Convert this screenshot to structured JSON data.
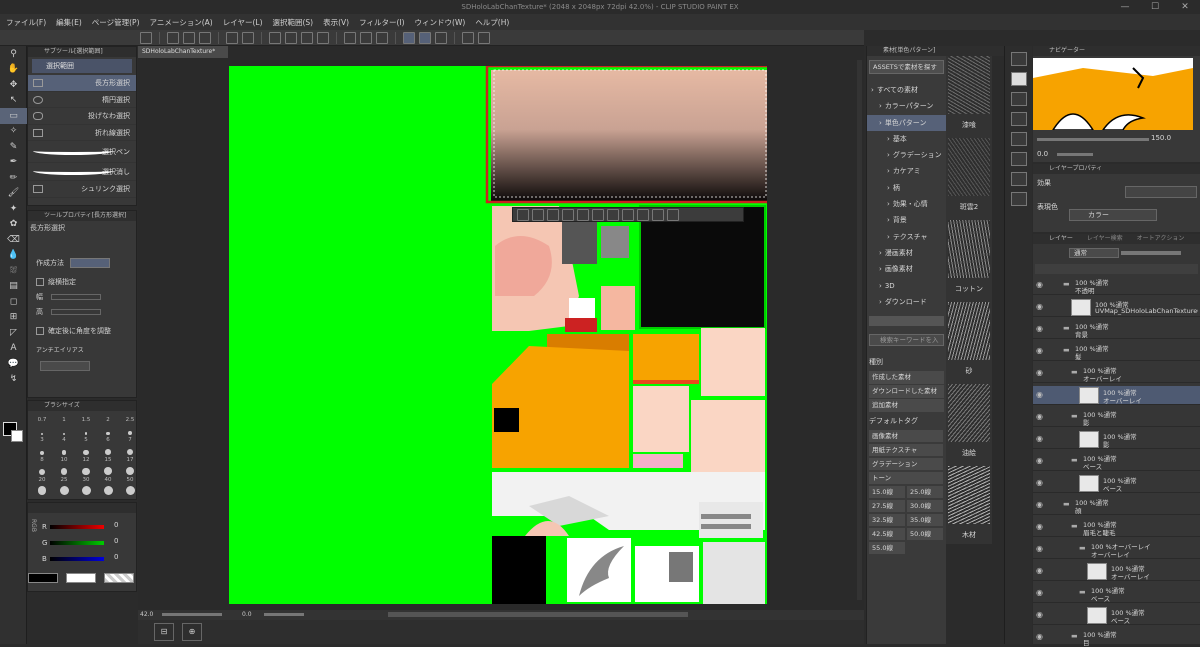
{
  "window": {
    "title": "SDHoloLabChanTexture* (2048 x 2048px 72dpi 42.0%) - CLIP STUDIO PAINT EX"
  },
  "menu": [
    "ファイル(F)",
    "編集(E)",
    "ページ管理(P)",
    "アニメーション(A)",
    "レイヤー(L)",
    "選択範囲(S)",
    "表示(V)",
    "フィルター(I)",
    "ウィンドウ(W)",
    "ヘルプ(H)"
  ],
  "subtool": {
    "header": "サブツール[選択範囲]",
    "tab": "選択範囲",
    "items": [
      "長方形選択",
      "楕円選択",
      "投げなわ選択",
      "折れ線選択",
      "選択ペン",
      "選択消し",
      "シュリンク選択"
    ]
  },
  "toolprop": {
    "header": "ツールプロパティ[長方形選択]",
    "name": "長方形選択",
    "create_method": "作成方法",
    "aspect": "縦横指定",
    "width_label": "幅",
    "height_label": "高",
    "rotate": "確定後に角度を調整",
    "antialias": "アンチエイリアス"
  },
  "brushsize": {
    "header": "ブラシサイズ",
    "sizes": [
      "0.7",
      "1",
      "1.5",
      "2",
      "2.5",
      "3",
      "4",
      "5",
      "6",
      "7",
      "8",
      "10",
      "12",
      "15",
      "17",
      "20",
      "25",
      "30",
      "40",
      "50"
    ]
  },
  "color": {
    "labels": [
      "R",
      "G",
      "B"
    ],
    "values": [
      "0",
      "0",
      "0"
    ],
    "side_tabs": [
      "RGB",
      "HSV",
      "CMY"
    ]
  },
  "document": {
    "tab": "SDHoloLabChanTexture*",
    "zoom": "42.0",
    "angle": "0.0"
  },
  "materials": {
    "header": "素材[単色パターン]",
    "assets_button": "ASSETSで素材を探す",
    "tree": [
      "すべての素材",
      "カラーパターン",
      "単色パターン",
      "基本",
      "グラデーション",
      "カケアミ",
      "柄",
      "効果・心情",
      "背景",
      "テクスチャ",
      "漫画素材",
      "画像素材",
      "3D",
      "ダウンロード"
    ],
    "search_placeholder": "検索キーワードを入",
    "kind_label": "種別",
    "kinds": [
      "作成した素材",
      "ダウンロードした素材",
      "追加素材"
    ],
    "default_tags_label": "デフォルトタグ",
    "tags": [
      "画像素材",
      "用紙テクスチャ",
      "グラデーション",
      "トーン",
      "15.0線",
      "25.0線",
      "27.5線",
      "30.0線",
      "32.5線",
      "35.0線",
      "42.5線",
      "50.0線",
      "55.0線"
    ],
    "thumbs": [
      "漆喰",
      "斑雲2",
      "コットン",
      "砂",
      "油絵",
      "木材"
    ]
  },
  "navigator": {
    "header": "ナビゲーター",
    "zoom": "150.0",
    "angle": "0.0"
  },
  "layer_property": {
    "header": "レイヤープロパティ",
    "effect": "効果",
    "expression_color": "表現色",
    "color_value": "カラー"
  },
  "layers": {
    "tabs": [
      "レイヤー",
      "レイヤー検索",
      "オートアクション"
    ],
    "blend": "通常",
    "opacity": "100",
    "rows": [
      {
        "mode": "100 %通常",
        "name": "不透明"
      },
      {
        "mode": "100 %通常",
        "name": "UVMap_SDHoloLabChanTextureCh"
      },
      {
        "mode": "100 %通常",
        "name": "背景"
      },
      {
        "mode": "100 %通常",
        "name": "髪"
      },
      {
        "mode": "100 %通常",
        "name": "オーバーレイ"
      },
      {
        "mode": "100 %通常",
        "name": "オーバーレイ"
      },
      {
        "mode": "100 %通常",
        "name": "影"
      },
      {
        "mode": "100 %通常",
        "name": "影"
      },
      {
        "mode": "100 %通常",
        "name": "ベース"
      },
      {
        "mode": "100 %通常",
        "name": "ベース"
      },
      {
        "mode": "100 %通常",
        "name": "顔"
      },
      {
        "mode": "100 %通常",
        "name": "眉毛と睫毛"
      },
      {
        "mode": "100 %オーバーレイ",
        "name": "オーバーレイ"
      },
      {
        "mode": "100 %通常",
        "name": "オーバーレイ"
      },
      {
        "mode": "100 %通常",
        "name": "ベース"
      },
      {
        "mode": "100 %通常",
        "name": "ベース"
      },
      {
        "mode": "100 %通常",
        "name": "目"
      }
    ]
  },
  "colors": {
    "green": "#00ff00",
    "orange": "#f7a300",
    "skin": "#f8d6c2",
    "selection": "#cc2222",
    "accent": "#566178"
  }
}
